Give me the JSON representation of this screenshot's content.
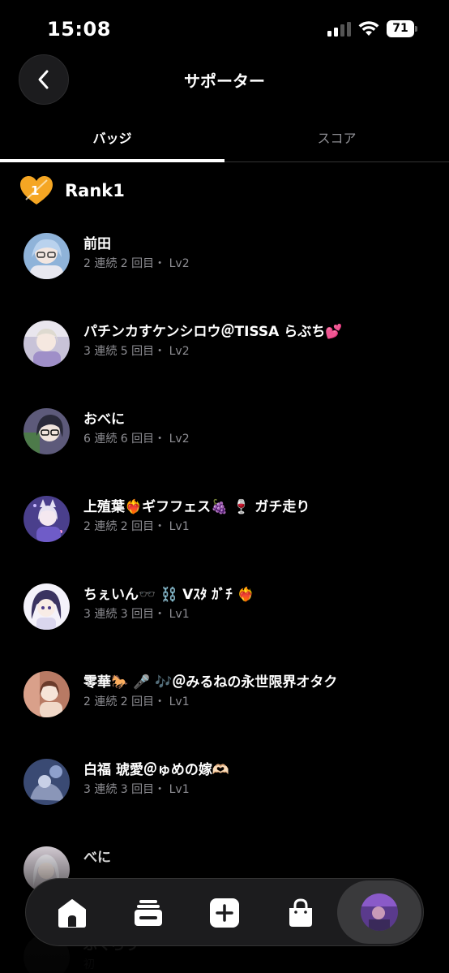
{
  "status_bar": {
    "time": "15:08",
    "battery": "71"
  },
  "header": {
    "title": "サポーター"
  },
  "tabs": [
    {
      "label": "バッジ",
      "active": true
    },
    {
      "label": "スコア",
      "active": false
    }
  ],
  "rank": {
    "label": "Rank1",
    "badge_text": "1",
    "badge_color": "#f5a623"
  },
  "supporters": [
    {
      "name": "前田",
      "meta": "2 連続 2 回目・ Lv2",
      "avatar_color": "#8fb3d9"
    },
    {
      "name": "パチンカすケンシロウ＠TISSA らぶち💕",
      "meta": "3 連続 5 回目・ Lv2",
      "avatar_color": "#c8c3d8"
    },
    {
      "name": "おべに",
      "meta": "6 連続 6 回目・ Lv2",
      "avatar_color": "#5d5a7a"
    },
    {
      "name": "上殖葉❤️‍🔥ギフフェス🍇 🍷 ガチ走り",
      "meta": "2 連続 2 回目・ Lv1",
      "avatar_color": "#4a3f8c"
    },
    {
      "name": "ちぇいん🕶️ ⛓️ Vｽﾀ ｶﾞﾁ ❤️‍🔥",
      "meta": "3 連続 3 回目・ Lv1",
      "avatar_color": "#dad6ee"
    },
    {
      "name": "零華🐎 🎤 🎶＠みるねの永世限界オタク",
      "meta": "2 連続 2 回目・ Lv1",
      "avatar_color": "#b87a64"
    },
    {
      "name": "白福 琥愛＠ゅめの嫁🫶🏻",
      "meta": "3 連続 3 回目・ Lv1",
      "avatar_color": "#3a4a73"
    },
    {
      "name": "べに",
      "meta": "",
      "avatar_color": "#d8d0d8"
    },
    {
      "name": "ぶくろう",
      "meta": "初",
      "avatar_color": "#555555"
    }
  ],
  "nav": {
    "items": [
      {
        "icon": "home-icon"
      },
      {
        "icon": "stack-icon"
      },
      {
        "icon": "plus-icon"
      },
      {
        "icon": "shopping-bag-icon"
      },
      {
        "icon": "profile-avatar"
      }
    ]
  }
}
